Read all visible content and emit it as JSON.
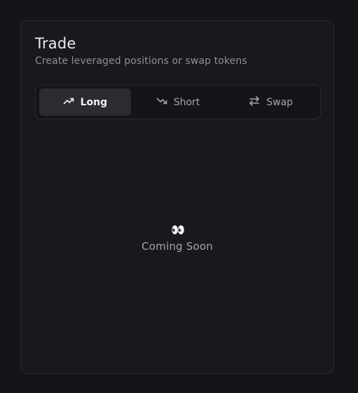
{
  "trade": {
    "title": "Trade",
    "subtitle": "Create leveraged positions or swap tokens"
  },
  "tabs": [
    {
      "label": "Long",
      "icon": "trending-up-icon",
      "active": true
    },
    {
      "label": "Short",
      "icon": "trending-down-icon",
      "active": false
    },
    {
      "label": "Swap",
      "icon": "swap-arrows-icon",
      "active": false
    }
  ],
  "empty_state": {
    "emoji": "👀",
    "text": "Coming Soon"
  },
  "colors": {
    "background": "#141518",
    "card": "#18191d",
    "active_tab": "#2b2c32",
    "muted_text": "#8e9098"
  }
}
